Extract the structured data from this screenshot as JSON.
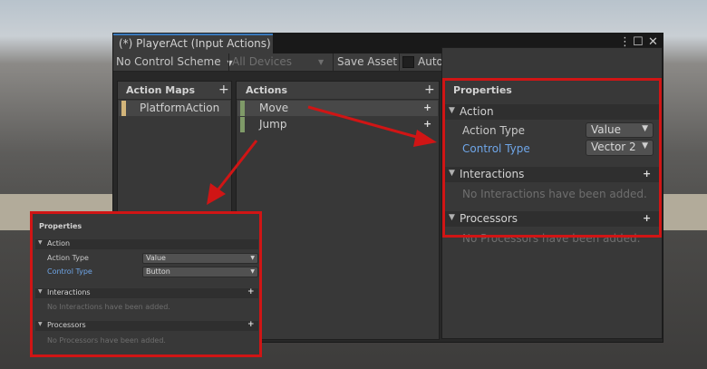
{
  "window": {
    "tab_title": "(*) PlayerAct (Input Actions)",
    "controls": [
      "⋮",
      "☐",
      "✕"
    ]
  },
  "toolbar": {
    "control_scheme": "No Control Scheme",
    "devices": "All Devices",
    "save_asset": "Save Asset",
    "auto_save": "Auto-Save",
    "search_value": ""
  },
  "action_maps": {
    "title": "Action Maps",
    "items": [
      {
        "label": "PlatformAction",
        "color": "#d3b57a"
      }
    ]
  },
  "actions": {
    "title": "Actions",
    "items": [
      {
        "label": "Move",
        "color": "#7f9a68"
      },
      {
        "label": "Jump",
        "color": "#7f9a68"
      }
    ]
  },
  "properties": {
    "title": "Properties",
    "action_section": "Action",
    "action_type_label": "Action Type",
    "action_type_value": "Value",
    "control_type_label": "Control Type",
    "control_type_value": "Vector 2",
    "interactions_section": "Interactions",
    "interactions_empty": "No Interactions have been added.",
    "processors_section": "Processors",
    "processors_empty": "No Processors have been added."
  },
  "zoomed_properties": {
    "title": "Properties",
    "action_section": "Action",
    "action_type_label": "Action Type",
    "action_type_value": "Value",
    "control_type_label": "Control Type",
    "control_type_value": "Button",
    "interactions_section": "Interactions",
    "interactions_empty": "No Interactions have been added.",
    "processors_section": "Processors",
    "processors_empty": "No Processors have been added."
  },
  "colors": {
    "highlight_red": "#d01515",
    "tab_accent": "#3a79bb",
    "blue_label": "#6fa6e8"
  }
}
